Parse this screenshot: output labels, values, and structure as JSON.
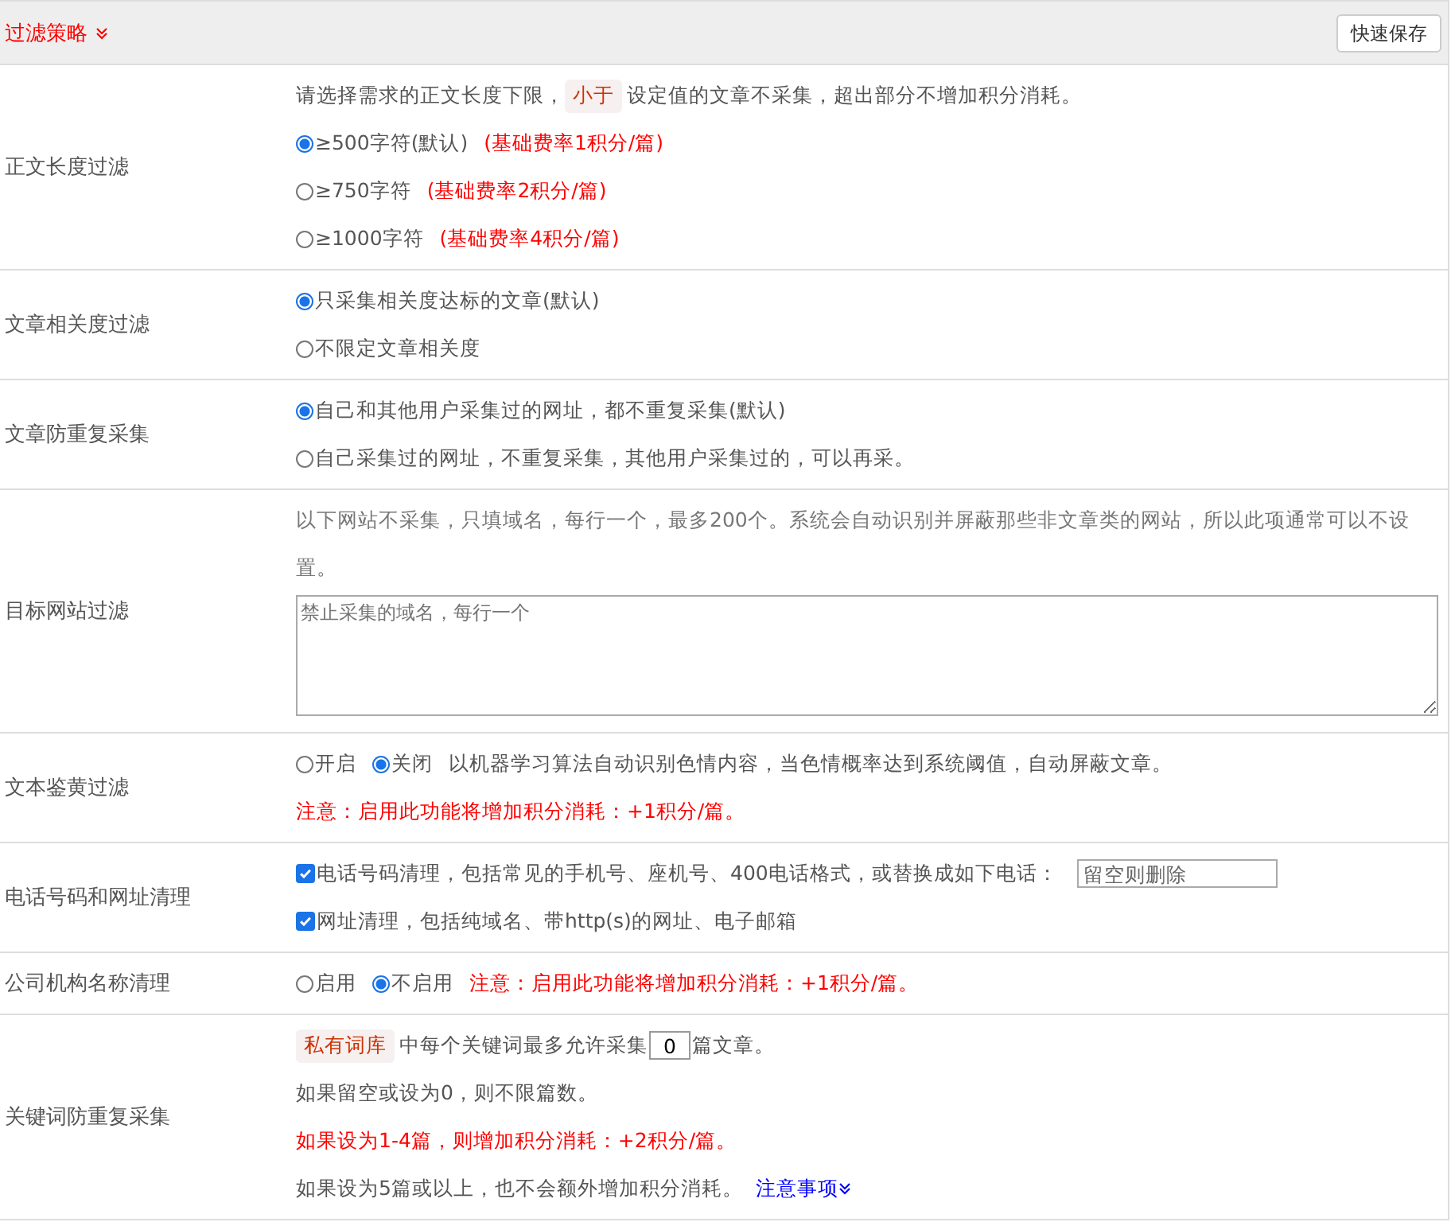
{
  "header": {
    "title": "过滤策略",
    "save_button": "快速保存"
  },
  "rows": [
    {
      "label": "正文长度过滤",
      "lines": [
        [
          {
            "kind": "text",
            "text": "请选择需求的正文长度下限，"
          },
          {
            "kind": "tag",
            "text": "小于"
          },
          {
            "kind": "text",
            "text": "设定值的文章不采集，超出部分不增加积分消耗。"
          }
        ],
        [
          {
            "kind": "radio",
            "label": "≥500字符(默认)",
            "selected": true
          },
          {
            "kind": "note",
            "text": "(基础费率1积分/篇)"
          }
        ],
        [
          {
            "kind": "radio",
            "label": "≥750字符",
            "selected": false
          },
          {
            "kind": "note",
            "text": "(基础费率2积分/篇)"
          }
        ],
        [
          {
            "kind": "radio",
            "label": "≥1000字符",
            "selected": false
          },
          {
            "kind": "note",
            "text": "(基础费率4积分/篇)"
          }
        ]
      ]
    },
    {
      "label": "文章相关度过滤",
      "lines": [
        [
          {
            "kind": "radio",
            "label": "只采集相关度达标的文章(默认)",
            "selected": true
          }
        ],
        [
          {
            "kind": "radio",
            "label": "不限定文章相关度",
            "selected": false
          }
        ]
      ]
    },
    {
      "label": "文章防重复采集",
      "lines": [
        [
          {
            "kind": "radio",
            "label": "自己和其他用户采集过的网址，都不重复采集(默认)",
            "selected": true
          }
        ],
        [
          {
            "kind": "radio",
            "label": "自己采集过的网址，不重复采集，其他用户采集过的，可以再采。",
            "selected": false
          }
        ]
      ]
    },
    {
      "label": "目标网站过滤",
      "lines": [
        [
          {
            "kind": "muted",
            "text": "以下网站不采集，只填域名，每行一个，最多200个。系统会自动识别并屏蔽那些非文章类的网站，所以此项通常可以不设置。"
          }
        ],
        [
          {
            "kind": "textarea",
            "placeholder": "禁止采集的域名，每行一个"
          }
        ]
      ]
    },
    {
      "label": "文本鉴黄过滤",
      "lines": [
        [
          {
            "kind": "radio",
            "label": "开启",
            "selected": false
          },
          {
            "kind": "radio",
            "label": "关闭",
            "selected": true
          },
          {
            "kind": "text",
            "text": "以机器学习算法自动识别色情内容，当色情概率达到系统阈值，自动屏蔽文章。"
          }
        ],
        [
          {
            "kind": "note",
            "text": "注意：启用此功能将增加积分消耗：+1积分/篇。"
          }
        ]
      ]
    },
    {
      "label": "电话号码和网址清理",
      "lines": [
        [
          {
            "kind": "checkbox",
            "label": "电话号码清理，包括常见的手机号、座机号、400电话格式，或替换成如下电话：",
            "checked": true
          },
          {
            "kind": "input",
            "placeholder": "留空则删除"
          }
        ],
        [
          {
            "kind": "checkbox",
            "label": "网址清理，包括纯域名、带http(s)的网址、电子邮箱",
            "checked": true
          }
        ]
      ]
    },
    {
      "label": "公司机构名称清理",
      "lines": [
        [
          {
            "kind": "radio",
            "label": "启用",
            "selected": false
          },
          {
            "kind": "radio",
            "label": "不启用",
            "selected": true
          },
          {
            "kind": "note",
            "text": "注意：启用此功能将增加积分消耗：+1积分/篇。"
          }
        ]
      ]
    },
    {
      "label": "关键词防重复采集",
      "lines": [
        [
          {
            "kind": "tag",
            "text": "私有词库"
          },
          {
            "kind": "text",
            "text": "中每个关键词最多允许采集"
          },
          {
            "kind": "number",
            "value": "0"
          },
          {
            "kind": "text",
            "text": "篇文章。"
          }
        ],
        [
          {
            "kind": "text",
            "text": "如果留空或设为0，则不限篇数。"
          }
        ],
        [
          {
            "kind": "note",
            "text": "如果设为1-4篇，则增加积分消耗：+2积分/篇。"
          }
        ],
        [
          {
            "kind": "text",
            "text": "如果设为5篇或以上，也不会额外增加积分消耗。"
          },
          {
            "kind": "link",
            "text": "注意事项"
          }
        ]
      ]
    }
  ]
}
